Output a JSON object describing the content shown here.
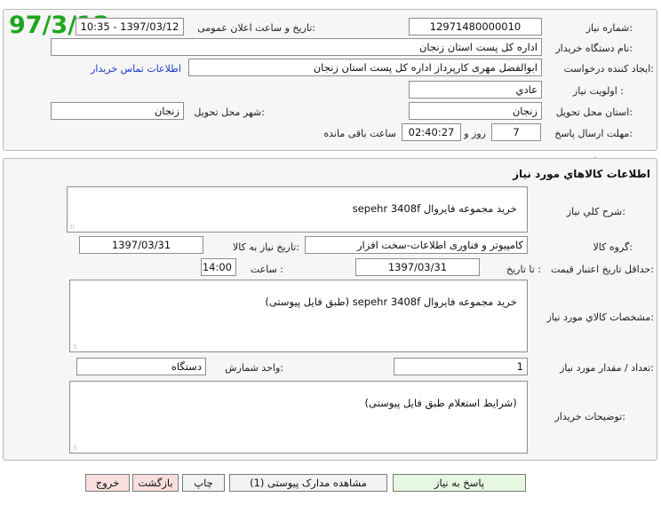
{
  "stamp": "97/3/12",
  "header": {
    "need_number_label": "شماره نیاز:",
    "need_number": "12971480000010",
    "announce_label": "تاریخ و ساعت اعلان عمومی:",
    "announce_value": "1397/03/12 - 10:35",
    "buyer_org_label": "نام دستگاه خریدار:",
    "buyer_org": "اداره کل پست استان زنجان",
    "creator_label": "ایجاد کننده درخواست:",
    "creator": "ابوالفضل مهری کارپرداز اداره کل پست استان زنجان",
    "contact_link": "اطلاعات تماس خریدار",
    "priority_label": "اولویت نیاز :",
    "priority": "عادي",
    "province_label": "استان محل تحویل:",
    "province": "زنجان",
    "city_label": "شهر محل تحویل:",
    "city": "زنجان",
    "deadline_label": "مهلت ارسال پاسخ:",
    "days": "7",
    "days_unit": "روز و",
    "time_remaining": "02:40:27",
    "time_remaining_label": "ساعت باقی مانده"
  },
  "goods": {
    "section_title": "اطلاعات کالاهاي مورد نياز",
    "summary_label": "شرح کلي نياز:",
    "summary": "خرید مجموعه فایروال sepehr 3408f",
    "group_label": "گروه کالا:",
    "group": "کامپیوتر و فناوری اطلاعات-سخت افزار",
    "need_date_label": "تاریخ نیاز به کالا:",
    "need_date": "1397/03/31",
    "price_validity_label": "حداقل تاریخ اعتبار قیمت:",
    "until_date_label": "تا تاریخ :",
    "until_date": "1397/03/31",
    "hour_label": "ساعت :",
    "hour": "14:00",
    "specs_label": "مشخصات کالاي مورد نياز:",
    "specs": "خرید مجموعه فایروال sepehr 3408f (طبق فایل پیوستی)",
    "quantity_label": "تعداد / مقدار مورد نیاز:",
    "quantity": "1",
    "unit_label": "واحد شمارش:",
    "unit": "دستگاه",
    "buyer_notes_label": "توضیحات خریدار:",
    "buyer_notes": "(شرایط استعلام طبق فایل پیوستی)"
  },
  "buttons": {
    "respond": "پاسخ به نیاز",
    "attachments": "مشاهده مدارک پیوستی (1)",
    "print": "چاپ",
    "back": "بازگشت",
    "exit": "خروج"
  },
  "colors": {
    "stamp": "#1fa51f",
    "link": "#1a3cc8",
    "respond_bg": "#e6f7e2",
    "exit_bg": "#f9dede"
  }
}
